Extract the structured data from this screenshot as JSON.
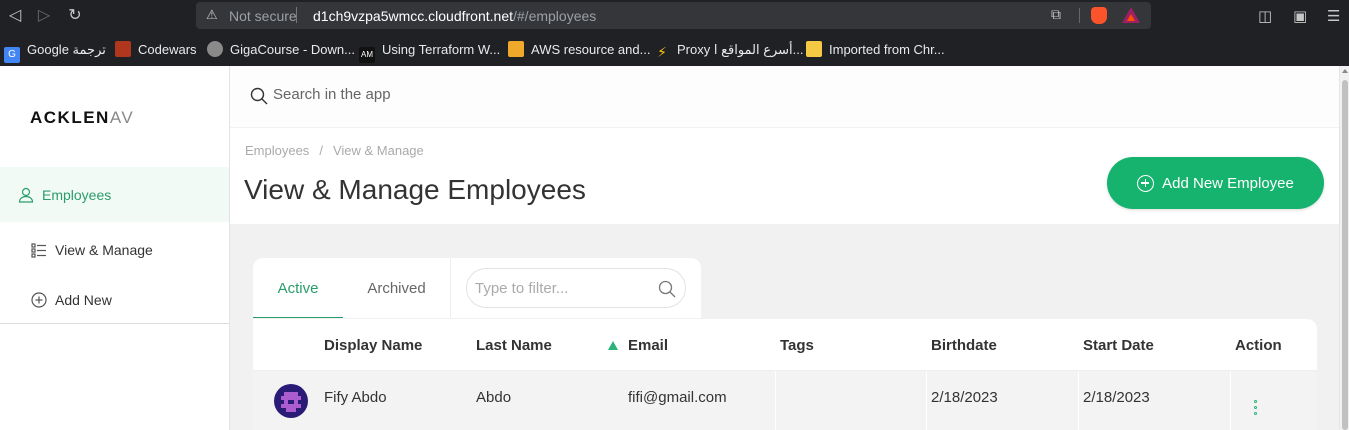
{
  "browser": {
    "not_secure": "Not secure",
    "url_host": "d1ch9vzpa5wmcc.cloudfront.net",
    "url_path": "/#/employees"
  },
  "bookmarks": [
    {
      "label": "Google ترجمة",
      "icon": "google-translate-icon",
      "color": "#4285f4"
    },
    {
      "label": "Codewars",
      "icon": "codewars-icon",
      "color": "#b1361e"
    },
    {
      "label": "GigaCourse - Down...",
      "icon": "gigacourse-icon",
      "color": "#8a8a8a"
    },
    {
      "label": "Using Terraform W...",
      "icon": "am-icon",
      "color": "#111111"
    },
    {
      "label": "AWS resource and...",
      "icon": "aws-cube-icon",
      "color": "#f0a92b"
    },
    {
      "label": "Proxy أسرع المواقع ا...",
      "icon": "lightning-icon",
      "color": "#f5c518"
    },
    {
      "label": "Imported from Chr...",
      "icon": "folder-icon",
      "color": "#f6c945"
    }
  ],
  "sidebar": {
    "logo_main": "ACKLEN",
    "logo_faded": "AV",
    "items": [
      {
        "label": "Employees",
        "icon": "user-icon"
      },
      {
        "label": "View & Manage",
        "icon": "list-icon"
      },
      {
        "label": "Add New",
        "icon": "plus-circle-icon"
      }
    ]
  },
  "search": {
    "placeholder": "Search in the app"
  },
  "breadcrumb": {
    "root": "Employees",
    "separator": "/",
    "current": "View & Manage"
  },
  "page_title": "View & Manage Employees",
  "add_button": "Add New Employee",
  "tabs": [
    {
      "label": "Active"
    },
    {
      "label": "Archived"
    }
  ],
  "filter": {
    "placeholder": "Type to filter..."
  },
  "table": {
    "columns": [
      "Display Name",
      "Last Name",
      "Email",
      "Tags",
      "Birthdate",
      "Start Date",
      "Action"
    ],
    "rows": [
      {
        "display_name": "Fify Abdo",
        "last_name": "Abdo",
        "email": "fifi@gmail.com",
        "tags": "",
        "birthdate": "2/18/2023",
        "start_date": "2/18/2023"
      }
    ]
  },
  "colors": {
    "accent": "#16b36e",
    "accent_text": "#2a9d6c"
  }
}
